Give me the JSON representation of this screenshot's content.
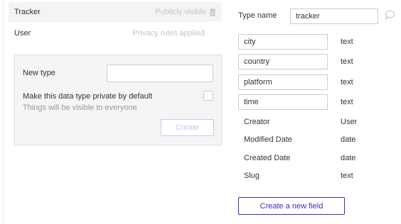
{
  "data_types": [
    {
      "name": "Tracker",
      "status": "Publicly visible",
      "selected": true
    },
    {
      "name": "User",
      "status": "Privacy rules applied",
      "selected": false
    }
  ],
  "new_type": {
    "label": "New type",
    "input_value": "",
    "private_label": "Make this data type private by default",
    "private_sub": "Things will be visible to everyone",
    "private_checked": false,
    "create_label": "Create"
  },
  "editor": {
    "type_name_label": "Type name",
    "type_name_value": "tracker",
    "fields": [
      {
        "name": "city",
        "type": "text"
      },
      {
        "name": "country",
        "type": "text"
      },
      {
        "name": "platform",
        "type": "text"
      },
      {
        "name": "time",
        "type": "text"
      }
    ],
    "builtin_fields": [
      {
        "name": "Creator",
        "type": "User"
      },
      {
        "name": "Modified Date",
        "type": "date"
      },
      {
        "name": "Created Date",
        "type": "date"
      },
      {
        "name": "Slug",
        "type": "text"
      }
    ],
    "create_field_label": "Create a new field"
  },
  "icons": {
    "trash": "trash-icon",
    "comment": "comment-icon"
  },
  "colors": {
    "accent": "#3b2db8",
    "disabled_accent": "#c9c6ec",
    "selected_bg": "#f4f4f4"
  }
}
